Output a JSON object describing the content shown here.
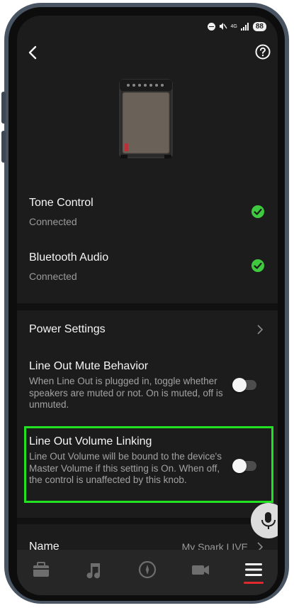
{
  "status_bar": {
    "network": "4G",
    "battery": "88"
  },
  "device_rows": [
    {
      "title": "Tone Control",
      "status": "Connected"
    },
    {
      "title": "Bluetooth Audio",
      "status": "Connected"
    }
  ],
  "settings": {
    "power": {
      "title": "Power Settings"
    },
    "mute": {
      "title": "Line Out Mute Behavior",
      "description": "When Line Out is plugged in, toggle whether speakers are muted or not. On is muted, off is unmuted.",
      "enabled": false
    },
    "volume_link": {
      "title": "Line Out Volume Linking",
      "description": "Line Out Volume will be bound to the device's Master Volume if this setting is On. When off, the control is unaffected by this knob.",
      "enabled": false
    },
    "name": {
      "title": "Name",
      "value": "My Spark LIVE"
    }
  },
  "nav": {
    "items": [
      "shop-icon",
      "music-note-icon",
      "compass-icon",
      "video-camera-icon",
      "menu-icon"
    ],
    "active": "menu-icon"
  },
  "colors": {
    "highlight": "#22e022",
    "check": "#3ec93e",
    "active_underline": "#e0282e"
  }
}
